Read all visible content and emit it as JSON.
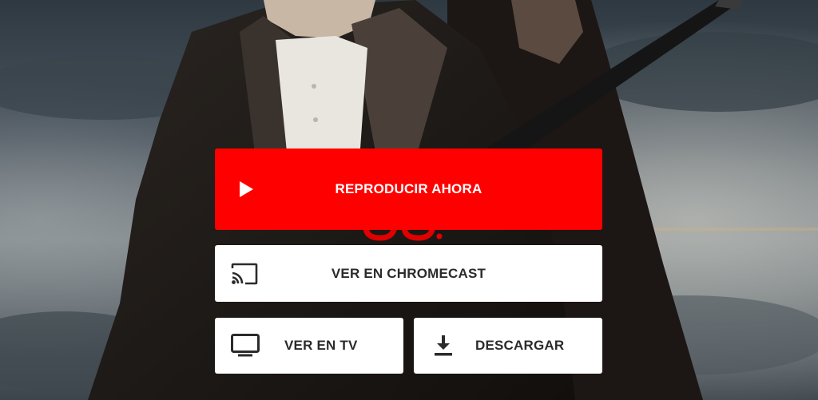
{
  "actions": {
    "play_label": "REPRODUCIR AHORA",
    "chromecast_label": "VER EN CHROMECAST",
    "tv_label": "VER EN TV",
    "download_label": "DESCARGAR"
  },
  "colors": {
    "primary": "#ff0000",
    "secondary_bg": "#ffffff",
    "secondary_text": "#2b2b2b"
  },
  "icons": {
    "play": "play-icon",
    "chromecast": "chromecast-icon",
    "tv": "tv-icon",
    "download": "download-icon"
  }
}
